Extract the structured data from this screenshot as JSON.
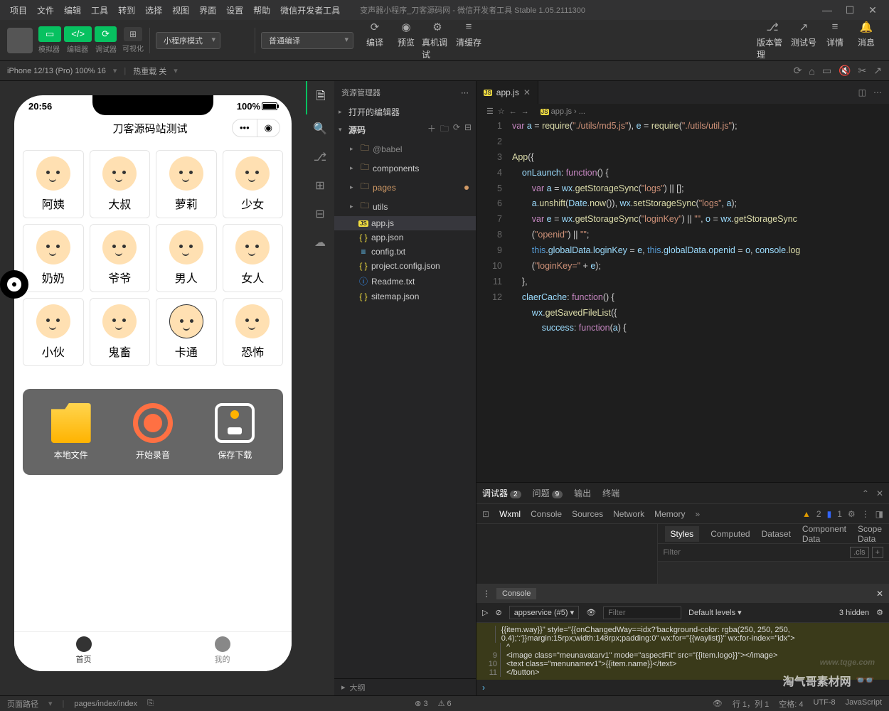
{
  "window": {
    "menus": [
      "项目",
      "文件",
      "编辑",
      "工具",
      "转到",
      "选择",
      "视图",
      "界面",
      "设置",
      "帮助",
      "微信开发者工具"
    ],
    "title_doc": "变声器小程序_刀客源码网",
    "title_app": "微信开发者工具 Stable 1.05.2111300"
  },
  "toolbar": {
    "group1_labels": [
      "模拟器",
      "编辑器",
      "调试器"
    ],
    "vis_label": "可视化",
    "mode_select": "小程序模式",
    "compile_select": "普通编译",
    "actions": {
      "compile": "编译",
      "preview": "预览",
      "remote": "真机调试",
      "cache": "清缓存"
    },
    "right": {
      "ver": "版本管理",
      "test": "测试号",
      "detail": "详情",
      "msg": "消息"
    }
  },
  "subbar": {
    "device": "iPhone 12/13 (Pro) 100% 16",
    "hot": "热重载 关"
  },
  "explorer": {
    "title": "资源管理器",
    "open_editors": "打开的编辑器",
    "root": "源码",
    "files": {
      "babel": "@babel",
      "components": "components",
      "pages": "pages",
      "utils": "utils",
      "appjs": "app.js",
      "appjson": "app.json",
      "config": "config.txt",
      "projcfg": "project.config.json",
      "readme": "Readme.txt",
      "sitemap": "sitemap.json"
    },
    "outline": "大纲"
  },
  "simulator": {
    "time": "20:56",
    "battery": "100%",
    "app_title": "刀客源码站测试",
    "cells": [
      "阿姨",
      "大叔",
      "萝莉",
      "少女",
      "奶奶",
      "爷爷",
      "男人",
      "女人",
      "小伙",
      "鬼畜",
      "卡通",
      "恐怖"
    ],
    "actions": {
      "local": "本地文件",
      "record": "开始录音",
      "save": "保存下载"
    },
    "tabs": {
      "home": "首页",
      "mine": "我的"
    }
  },
  "editor": {
    "tab": "app.js",
    "crumb_file": "app.js",
    "lines": [
      "1",
      "2",
      "3",
      "4",
      "5",
      "6",
      "7",
      "8",
      "9",
      "10",
      "11",
      "12"
    ]
  },
  "devtools": {
    "top": {
      "debug": "调试器",
      "debug_n": "2",
      "problem": "问题",
      "problem_n": "9",
      "output": "输出",
      "terminal": "终端"
    },
    "tabs": {
      "wxml": "Wxml",
      "console": "Console",
      "sources": "Sources",
      "network": "Network",
      "memory": "Memory"
    },
    "warn": "2",
    "info": "1",
    "styles": {
      "styles": "Styles",
      "computed": "Computed",
      "dataset": "Dataset",
      "compdata": "Component Data",
      "scope": "Scope Data"
    },
    "filter_ph": "Filter",
    "cls": ".cls",
    "console": {
      "label": "Console",
      "ctx": "appservice (#5)",
      "filter_ph": "Filter",
      "levels": "Default levels",
      "hidden": "3 hidden"
    },
    "cons_lines": [
      "{{item.way}}\" style=\"{{onChangedWay==idx?'background-color: rgba(250, 250, 250, 0.4);':'}}margin:15rpx;width:148rpx;padding:0\" wx:for=\"{{waylist}}\" wx:for-index=\"idx\">",
      "            ^",
      "            <image class=\"meunavatarv1\" mode=\"aspectFit\" src=\"{{item.logo}}\"></image>",
      "            <text class=\"menunamev1\">{{item.name}}</text>",
      "        </button>"
    ],
    "cons_ln": [
      "",
      "",
      "9",
      "10",
      "11"
    ]
  },
  "statusbar": {
    "path_lbl": "页面路径",
    "path": "pages/index/index",
    "err": "3",
    "warn": "6",
    "right": {
      "pos": "行 1，列 1",
      "spaces": "空格: 4",
      "enc": "UTF-8",
      "lang": "JavaScript"
    }
  },
  "watermark": {
    "text": "淘气哥素材网",
    "url": "www.tqge.com"
  }
}
